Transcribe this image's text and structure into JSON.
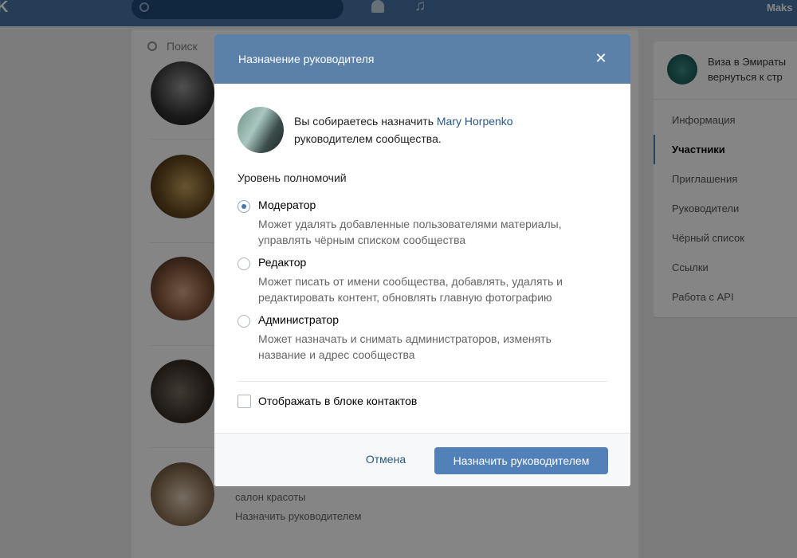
{
  "topbar": {
    "logo": "K",
    "user_name": "Maks"
  },
  "members": {
    "search_placeholder": "Поиск",
    "last_member_subtitle": "салон красоты",
    "last_member_action": "Назначить руководителем"
  },
  "side": {
    "group_name_line1": "Виза в Эмираты",
    "group_name_line2": "вернуться к стр",
    "items": [
      {
        "label": "Информация"
      },
      {
        "label": "Участники"
      },
      {
        "label": "Приглашения"
      },
      {
        "label": "Руководители"
      },
      {
        "label": "Чёрный список"
      },
      {
        "label": "Ссылки"
      },
      {
        "label": "Работа с API"
      }
    ]
  },
  "modal": {
    "title": "Назначение руководителя",
    "intro_prefix": "Вы собираетесь назначить ",
    "person_name": "Mary Horpenko",
    "intro_suffix": "руководителем сообщества.",
    "level_title": "Уровень полномочий",
    "options": [
      {
        "label": "Модератор",
        "description": "Может удалять добавленные пользователями материалы, управлять чёрным списком сообщества",
        "selected": true
      },
      {
        "label": "Редактор",
        "description": "Может писать от имени сообщества, добавлять, удалять и редактировать контент, обновлять главную фотографию",
        "selected": false
      },
      {
        "label": "Администратор",
        "description": "Может назначать и снимать администраторов, изменять название и адрес сообщества",
        "selected": false
      }
    ],
    "contacts_checkbox_label": "Отображать в блоке контактов",
    "cancel_label": "Отмена",
    "submit_label": "Назначить руководителем"
  },
  "colors": {
    "topbar": "#4a76a8",
    "modal_header": "#5b81a9",
    "primary_button": "#5181b8",
    "link": "#2a5885"
  }
}
